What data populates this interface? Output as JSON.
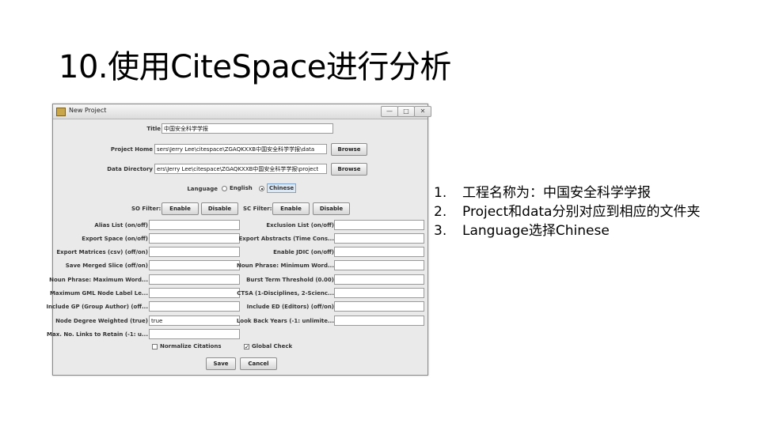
{
  "slide": {
    "title": "10.使用CiteSpace进行分析"
  },
  "window": {
    "title": "New Project",
    "controls": {
      "minimize": "—",
      "maximize": "□",
      "close": "✕"
    }
  },
  "form": {
    "title_label": "Title",
    "title_value": "中国安全科学学报",
    "project_home_label": "Project Home",
    "project_home_value": "sers\\Jerry Lee\\citespace\\ZGAQKXXB中国安全科学学报\\data",
    "data_directory_label": "Data Directory",
    "data_directory_value": "ers\\Jerry Lee\\citespace\\ZGAQKXXB中国安全科学学报\\project",
    "browse_label": "Browse",
    "language_label": "Language",
    "english_label": "English",
    "chinese_label": "Chinese",
    "language_selected": "Chinese",
    "so_filter_label": "SO Filter:",
    "sc_filter_label": "SC Filter:",
    "enable_label": "Enable",
    "disable_label": "Disable",
    "left_fields": [
      {
        "label": "Alias List (on/off)",
        "value": ""
      },
      {
        "label": "Export Space (on/off)",
        "value": ""
      },
      {
        "label": "Export Matrices (csv) (off/on)",
        "value": ""
      },
      {
        "label": "Save Merged Slice (off/on)",
        "value": ""
      },
      {
        "label": "Noun Phrase: Maximum Word...",
        "value": ""
      },
      {
        "label": "Maximum GML Node Label Le...",
        "value": ""
      },
      {
        "label": "Include GP (Group Author) (off...",
        "value": ""
      },
      {
        "label": "Node Degree Weighted (true)",
        "value": "true"
      },
      {
        "label": "Max. No. Links to Retain (-1: u...",
        "value": ""
      }
    ],
    "right_fields": [
      {
        "label": "Exclusion List (on/off)",
        "value": ""
      },
      {
        "label": "Export Abstracts (Time Cons...",
        "value": ""
      },
      {
        "label": "Enable JDIC (on/off)",
        "value": ""
      },
      {
        "label": "Noun Phrase: Minimum Word...",
        "value": ""
      },
      {
        "label": "Burst Term Threshold (0.00)",
        "value": ""
      },
      {
        "label": "CTSA (1-Disciplines, 2-Scienc...",
        "value": ""
      },
      {
        "label": "Include ED (Editors) (off/on)",
        "value": ""
      },
      {
        "label": "Look Back Years (-1: unlimite...",
        "value": ""
      }
    ],
    "normalize_label": "Normalize Citations",
    "global_check_label": "Global Check",
    "save_label": "Save",
    "cancel_label": "Cancel"
  },
  "notes": [
    {
      "num": "1.",
      "text": "工程名称为：中国安全科学学报"
    },
    {
      "num": "2.",
      "text": "Project和data分别对应到相应的文件夹"
    },
    {
      "num": "3.",
      "text": "Language选择Chinese"
    }
  ]
}
